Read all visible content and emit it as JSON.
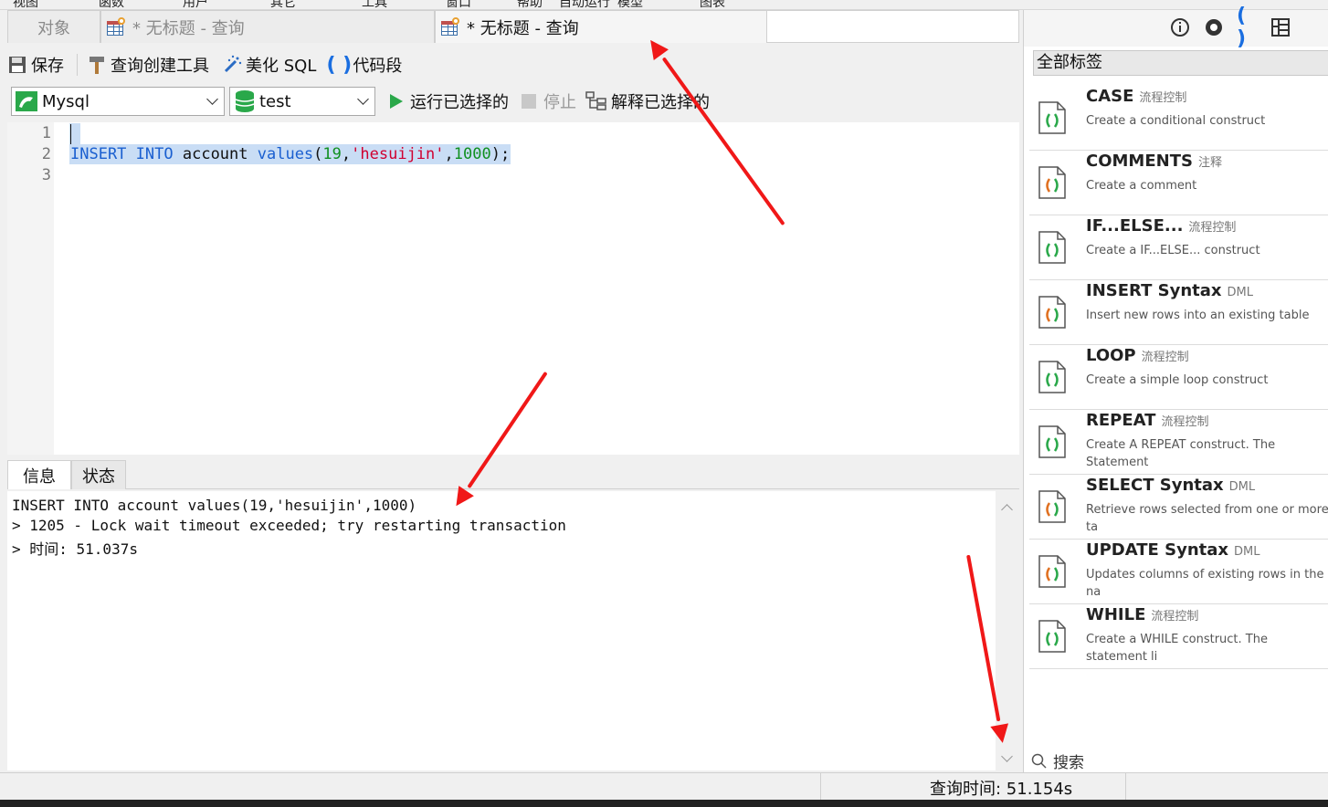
{
  "menubar": [
    "视图",
    "函数",
    "用户",
    "其它",
    "工具",
    "窗口",
    "帮助",
    "自动运行",
    "模型",
    "图表"
  ],
  "tabs": {
    "objects": "对象",
    "tab1": "* 无标题 - 查询",
    "tab2": "* 无标题 - 查询"
  },
  "toolbar": {
    "save": "保存",
    "builder": "查询创建工具",
    "beautify": "美化 SQL",
    "snippet": "代码段"
  },
  "connection": {
    "name": "Mysql",
    "database": "test",
    "run": "运行已选择的",
    "stop": "停止",
    "explain": "解释已选择的"
  },
  "editor": {
    "line_numbers": [
      "1",
      "2",
      "3"
    ],
    "tokens": [
      {
        "t": "INSERT",
        "c": "kw"
      },
      {
        "t": " ",
        "c": "plain"
      },
      {
        "t": "INTO",
        "c": "kw"
      },
      {
        "t": " account ",
        "c": "plain"
      },
      {
        "t": "values",
        "c": "kw"
      },
      {
        "t": "(",
        "c": "plain"
      },
      {
        "t": "19",
        "c": "num"
      },
      {
        "t": ",",
        "c": "plain"
      },
      {
        "t": "'hesuijin'",
        "c": "str"
      },
      {
        "t": ",",
        "c": "plain"
      },
      {
        "t": "1000",
        "c": "num"
      },
      {
        "t": ");",
        "c": "plain"
      }
    ]
  },
  "result_tabs": {
    "info": "信息",
    "status": "状态"
  },
  "output": {
    "line1": "INSERT INTO account values(19,'hesuijin',1000)",
    "line2": "> 1205 - Lock wait timeout exceeded; try restarting transaction",
    "line3": "> 时间: 51.037s"
  },
  "statusbar": {
    "query_time": "查询时间: 51.154s"
  },
  "panel": {
    "header": "全部标签",
    "search_placeholder": "搜索",
    "snippets": [
      {
        "title": "CASE",
        "category": "流程控制",
        "desc": "Create a conditional construct",
        "icon_color": "#2aa84a"
      },
      {
        "title": "COMMENTS",
        "category": "注释",
        "desc": "Create a comment",
        "icon_color": "#e07020"
      },
      {
        "title": "IF...ELSE...",
        "category": "流程控制",
        "desc": "Create a IF...ELSE... construct",
        "icon_color": "#2aa84a"
      },
      {
        "title": "INSERT Syntax",
        "category": "DML",
        "desc": "Insert new rows into an existing table",
        "icon_color": "#e07020"
      },
      {
        "title": "LOOP",
        "category": "流程控制",
        "desc": "Create a simple loop construct",
        "icon_color": "#2aa84a"
      },
      {
        "title": "REPEAT",
        "category": "流程控制",
        "desc": "Create A REPEAT construct. The Statement\nuntil the search_condition expression is true",
        "icon_color": "#2aa84a"
      },
      {
        "title": "SELECT Syntax",
        "category": "DML",
        "desc": "Retrieve rows selected from one or more ta",
        "icon_color": "#e07020"
      },
      {
        "title": "UPDATE Syntax",
        "category": "DML",
        "desc": "Updates columns of existing rows in the na\nnew values",
        "icon_color": "#e07020"
      },
      {
        "title": "WHILE",
        "category": "流程控制",
        "desc": "Create a WHILE construct. The statement li\nWHILE statement is repeated as long as the\nsearch_condition expression is true.",
        "icon_color": "#2aa84a"
      }
    ]
  },
  "colors": {
    "accent": "#1a5fd0",
    "arrow": "#f01818",
    "selection": "#c9ddf5"
  }
}
